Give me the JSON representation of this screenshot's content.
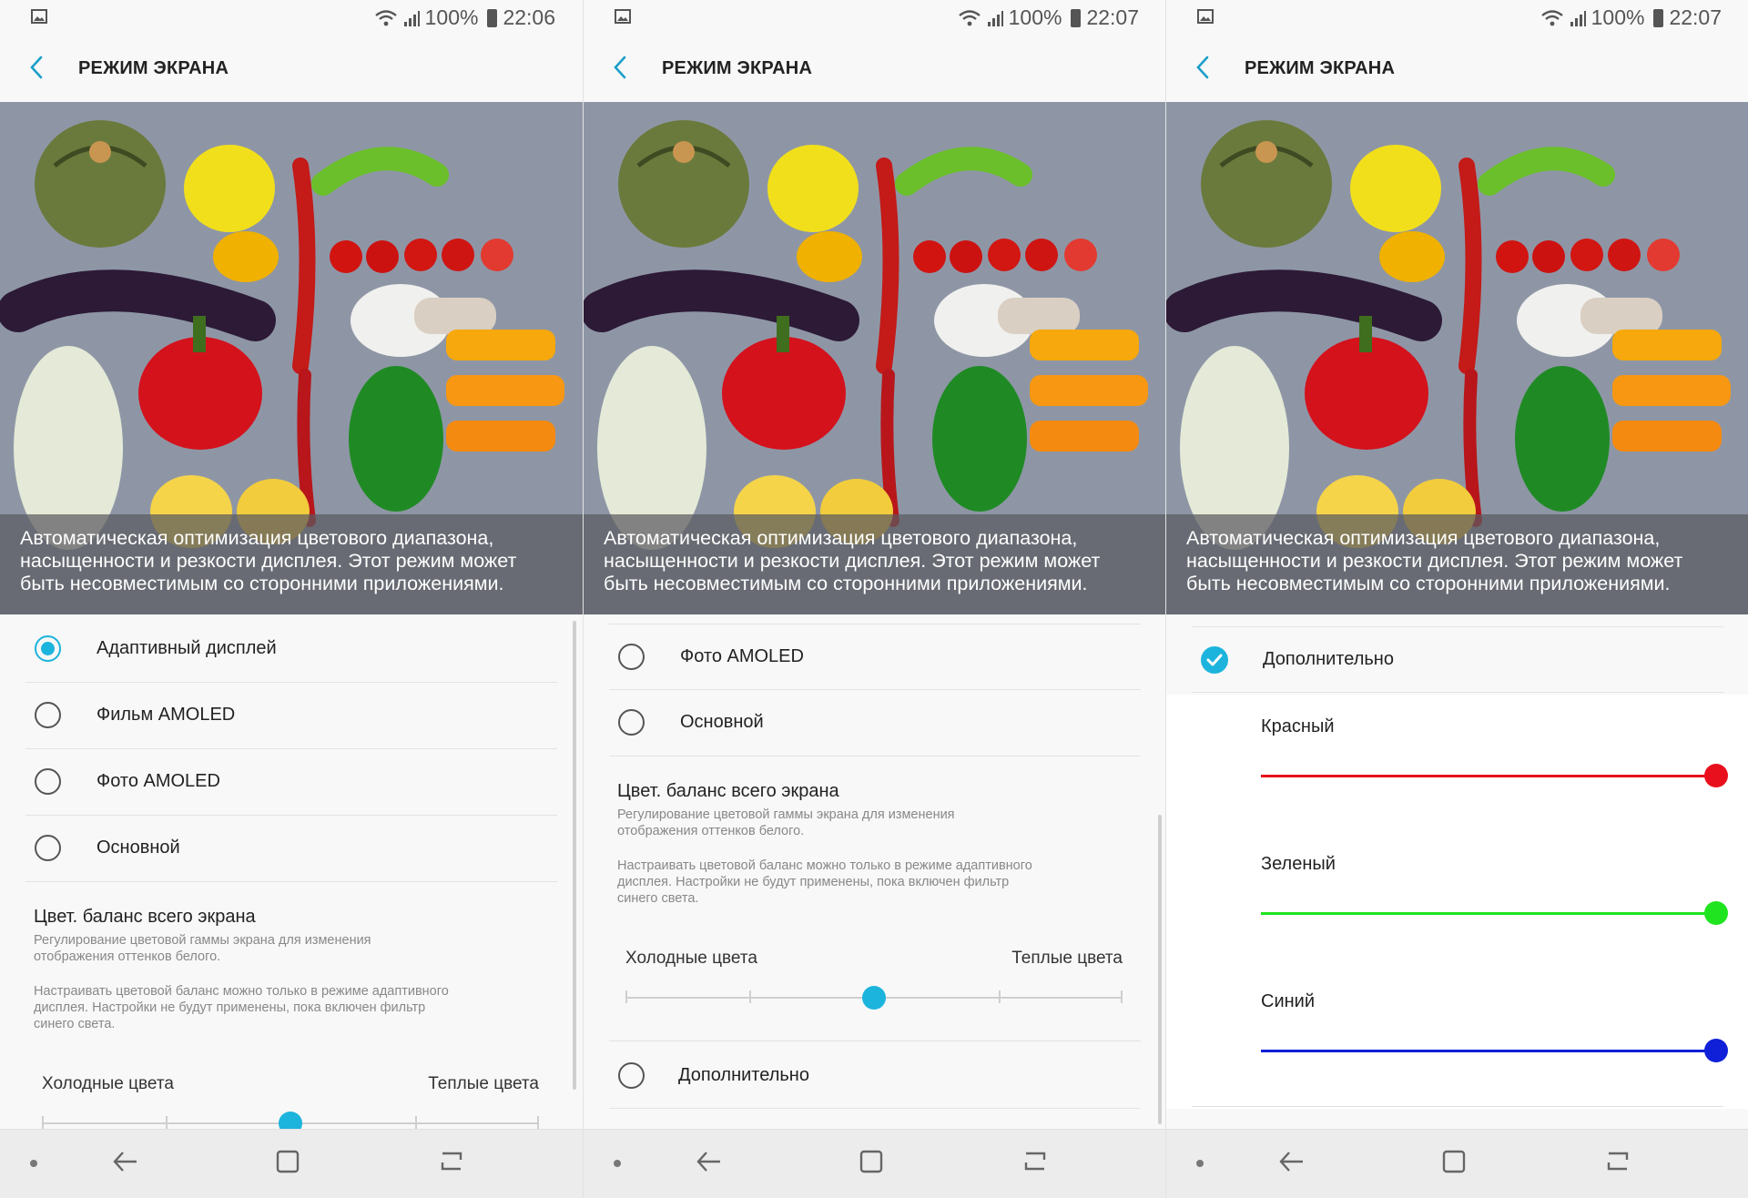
{
  "screens": [
    {
      "status": {
        "battery": "100%",
        "time": "22:06"
      },
      "title": "РЕЖИМ ЭКРАНА",
      "caption": "Автоматическая оптимизация цветового диапазона, насыщенности и резкости дисплея. Этот режим может быть несовместимым со сторонними приложениями.",
      "options": [
        {
          "label": "Адаптивный дисплей",
          "selected": true
        },
        {
          "label": "Фильм AMOLED",
          "selected": false
        },
        {
          "label": "Фото AMOLED",
          "selected": false
        },
        {
          "label": "Основной",
          "selected": false
        }
      ],
      "balance": {
        "title": "Цвет. баланс всего экрана",
        "desc1": "Регулирование цветовой гаммы экрана для изменения отображения оттенков белого.",
        "desc2": "Настраивать цветовой баланс можно только в режиме адаптивного дисплея. Настройки не будут применены, пока включен фильтр синего света.",
        "cold": "Холодные цвета",
        "warm": "Теплые цвета",
        "value": 0.5
      }
    },
    {
      "status": {
        "battery": "100%",
        "time": "22:07"
      },
      "title": "РЕЖИМ ЭКРАНА",
      "caption": "Автоматическая оптимизация цветового диапазона, насыщенности и резкости дисплея. Этот режим может быть несовместимым со сторонними приложениями.",
      "options": [
        {
          "label": "Фото AMOLED",
          "selected": false
        },
        {
          "label": "Основной",
          "selected": false
        }
      ],
      "balance": {
        "title": "Цвет. баланс всего экрана",
        "desc1": "Регулирование цветовой гаммы экрана для изменения отображения оттенков белого.",
        "desc2": "Настраивать цветовой баланс можно только в режиме адаптивного дисплея. Настройки не будут применены, пока включен фильтр синего света.",
        "cold": "Холодные цвета",
        "warm": "Теплые цвета",
        "value": 0.5
      },
      "advanced": {
        "label": "Дополнительно",
        "selected": false
      }
    },
    {
      "status": {
        "battery": "100%",
        "time": "22:07"
      },
      "title": "РЕЖИМ ЭКРАНА",
      "caption": "Автоматическая оптимизация цветового диапазона, насыщенности и резкости дисплея. Этот режим может быть несовместимым со сторонними приложениями.",
      "advanced": {
        "label": "Дополнительно",
        "selected": true
      },
      "rgb": [
        {
          "label": "Красный",
          "color": "#e8101c",
          "value": 1.0
        },
        {
          "label": "Зеленый",
          "color": "#1fe41f",
          "value": 1.0
        },
        {
          "label": "Синий",
          "color": "#1020d8",
          "value": 1.0
        }
      ]
    }
  ],
  "colors": {
    "accent": "#1cb4dc"
  }
}
